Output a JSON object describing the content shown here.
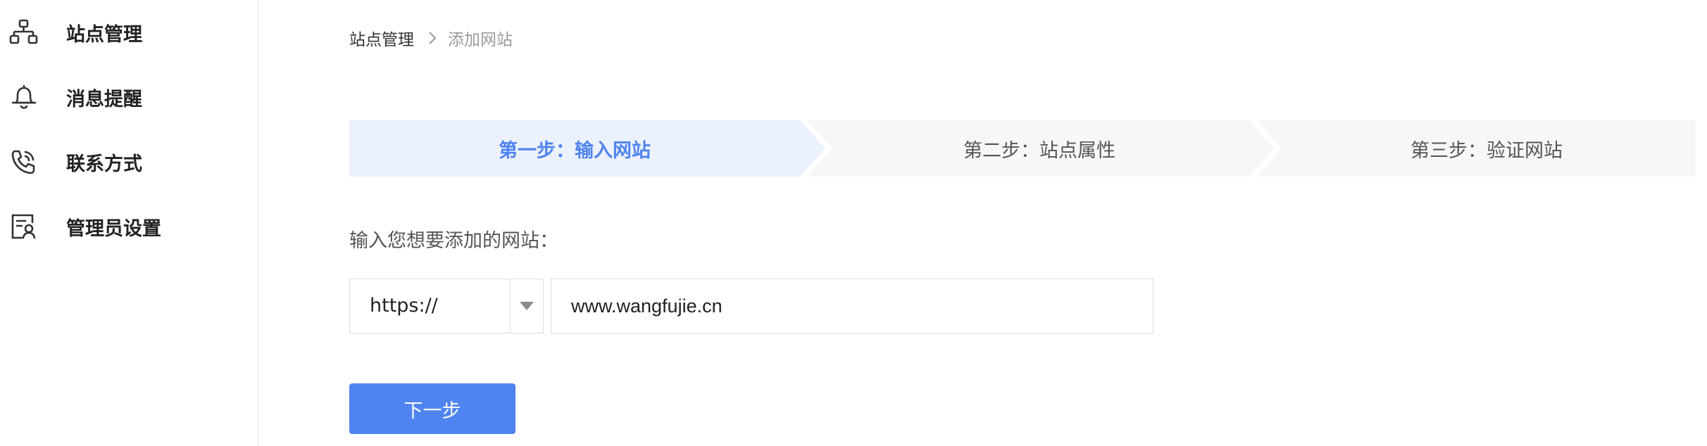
{
  "sidebar": {
    "items": [
      {
        "label": "站点管理",
        "icon": "sitemap-icon"
      },
      {
        "label": "消息提醒",
        "icon": "bell-icon"
      },
      {
        "label": "联系方式",
        "icon": "phone-icon"
      },
      {
        "label": "管理员设置",
        "icon": "admin-icon"
      }
    ]
  },
  "breadcrumb": {
    "root": "站点管理",
    "current": "添加网站"
  },
  "steps": [
    {
      "label": "第一步：输入网站",
      "active": true
    },
    {
      "label": "第二步：站点属性",
      "active": false
    },
    {
      "label": "第三步：验证网站",
      "active": false
    }
  ],
  "form": {
    "prompt": "输入您想要添加的网站：",
    "protocol": "https://",
    "url": "www.wangfujie.cn",
    "next_label": "下一步"
  },
  "colors": {
    "accent": "#4f84f0",
    "step_active_bg": "#ebf1fd",
    "step_inactive_bg": "#f7f7f7"
  }
}
